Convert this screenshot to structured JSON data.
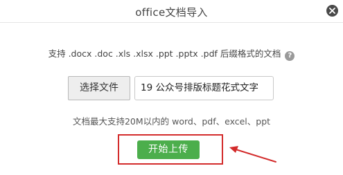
{
  "dialog": {
    "title": "office文档导入",
    "close_icon": "close-icon"
  },
  "hint": {
    "text": "支持 .docx .doc .xls .xlsx .ppt .pptx .pdf 后缀格式的文档",
    "help_icon": "question-mark-icon",
    "help_glyph": "?"
  },
  "file_picker": {
    "choose_label": "选择文件",
    "file_name": "19 公众号排版标题花式文字"
  },
  "limit_text": "文档最大支持20M以内的 word、pdf、excel、ppt",
  "upload_label": "开始上传",
  "colors": {
    "upload_button": "#4cae4c",
    "annotation_red": "#d32b2b",
    "close_button": "#4a4a4a"
  }
}
